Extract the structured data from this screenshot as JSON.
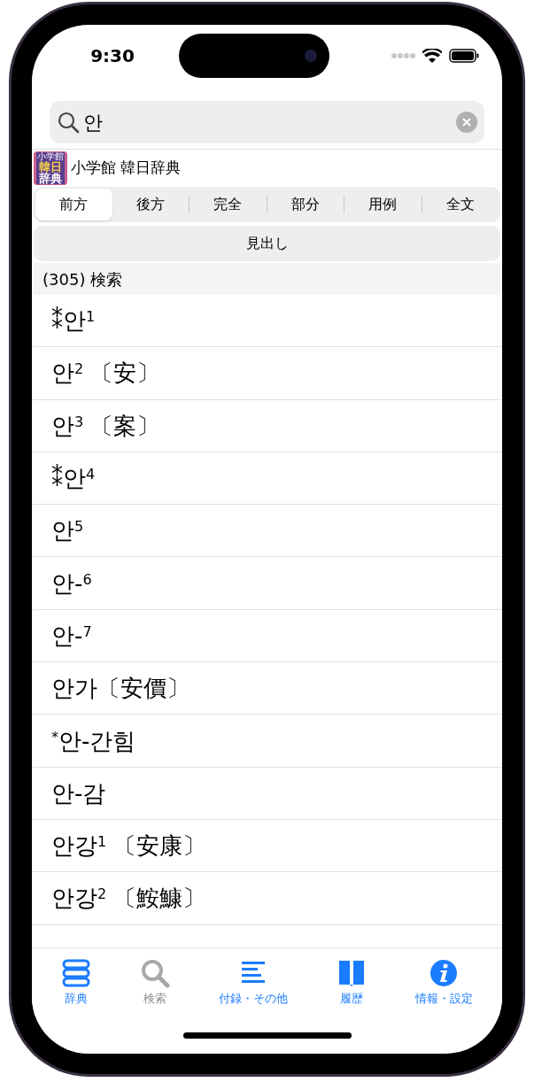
{
  "status_bar": {
    "time": "9:30"
  },
  "search": {
    "value": "안"
  },
  "dictionary": {
    "logo_lines": [
      "小学館",
      "韓日",
      "辞典"
    ],
    "title": "小学館 韓日辞典"
  },
  "match_modes": [
    {
      "label": "前方",
      "selected": true
    },
    {
      "label": "後方",
      "selected": false
    },
    {
      "label": "完全",
      "selected": false
    },
    {
      "label": "部分",
      "selected": false
    },
    {
      "label": "用例",
      "selected": false
    },
    {
      "label": "全文",
      "selected": false
    }
  ],
  "field_button": "見出し",
  "result_count": "(305) 検索",
  "results": [
    "⁑안$^{1}$",
    "안$^{2}$ 〔安〕",
    "안$^{3}$ 〔案〕",
    "⁑안$^{4}$",
    "안$^{5}$",
    "안-$^{6}$",
    "안-$^{7}$",
    "안가〔安價〕",
    "$^{*}$안-간힘",
    "안-감",
    "안강$^{1}$ 〔安康〕",
    "안강$^{2}$ 〔鮟鱇〕"
  ],
  "tab_bar": [
    {
      "kind": "books",
      "label": "辞典",
      "selected": false
    },
    {
      "kind": "search",
      "label": "検索",
      "selected": true
    },
    {
      "kind": "list",
      "label": "付録・その他",
      "selected": false
    },
    {
      "kind": "book",
      "label": "履歴",
      "selected": false
    },
    {
      "kind": "info",
      "label": "情報・設定",
      "selected": false
    }
  ]
}
